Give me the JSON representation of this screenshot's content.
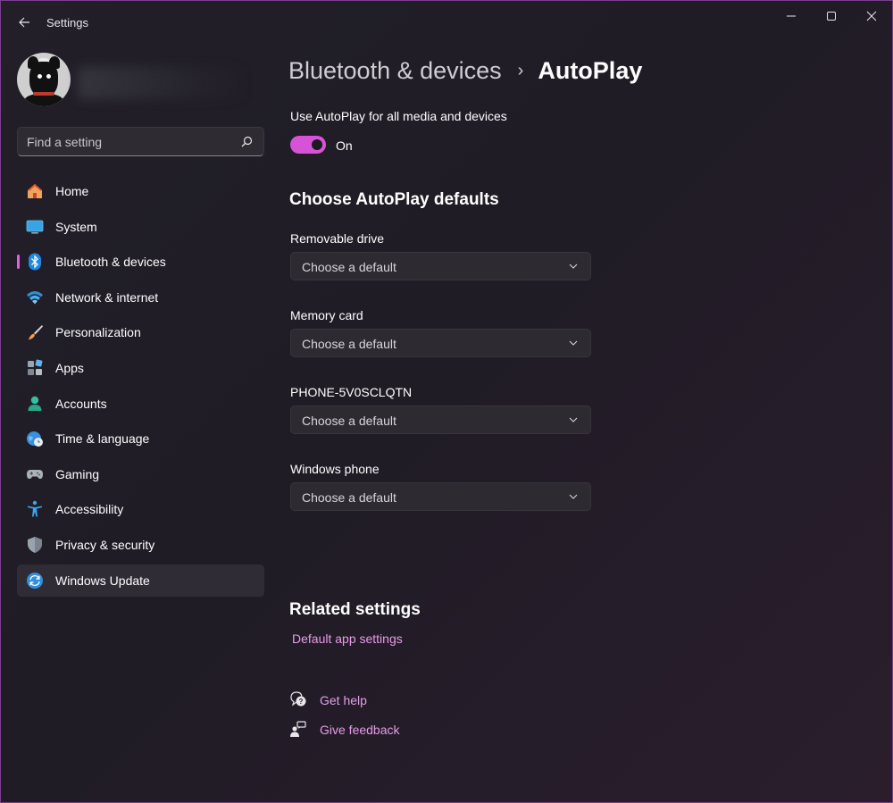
{
  "app": {
    "title": "Settings"
  },
  "search": {
    "placeholder": "Find a setting"
  },
  "sidebar": {
    "items": [
      {
        "label": "Home",
        "icon": "home-icon"
      },
      {
        "label": "System",
        "icon": "system-icon"
      },
      {
        "label": "Bluetooth & devices",
        "icon": "bluetooth-icon"
      },
      {
        "label": "Network & internet",
        "icon": "wifi-icon"
      },
      {
        "label": "Personalization",
        "icon": "brush-icon"
      },
      {
        "label": "Apps",
        "icon": "apps-icon"
      },
      {
        "label": "Accounts",
        "icon": "accounts-icon"
      },
      {
        "label": "Time & language",
        "icon": "globe-clock-icon"
      },
      {
        "label": "Gaming",
        "icon": "gamepad-icon"
      },
      {
        "label": "Accessibility",
        "icon": "accessibility-icon"
      },
      {
        "label": "Privacy & security",
        "icon": "shield-icon"
      },
      {
        "label": "Windows Update",
        "icon": "update-icon"
      }
    ],
    "selected_index": 2,
    "hover_index": 11
  },
  "breadcrumb": {
    "parent": "Bluetooth & devices",
    "separator": "›",
    "current": "AutoPlay"
  },
  "autoplay": {
    "toggle_label": "Use AutoPlay for all media and devices",
    "toggle_state": "On",
    "toggle_on": true
  },
  "defaults": {
    "title": "Choose AutoPlay defaults",
    "items": [
      {
        "label": "Removable drive",
        "value": "Choose a default"
      },
      {
        "label": "Memory card",
        "value": "Choose a default"
      },
      {
        "label": "PHONE-5V0SCLQTN",
        "value": "Choose a default"
      },
      {
        "label": "Windows phone",
        "value": "Choose a default"
      }
    ]
  },
  "related": {
    "title": "Related settings",
    "link": "Default app settings"
  },
  "help": {
    "get_help": "Get help",
    "give_feedback": "Give feedback"
  },
  "colors": {
    "accent": "#d653d8",
    "link": "#e79ce9"
  }
}
